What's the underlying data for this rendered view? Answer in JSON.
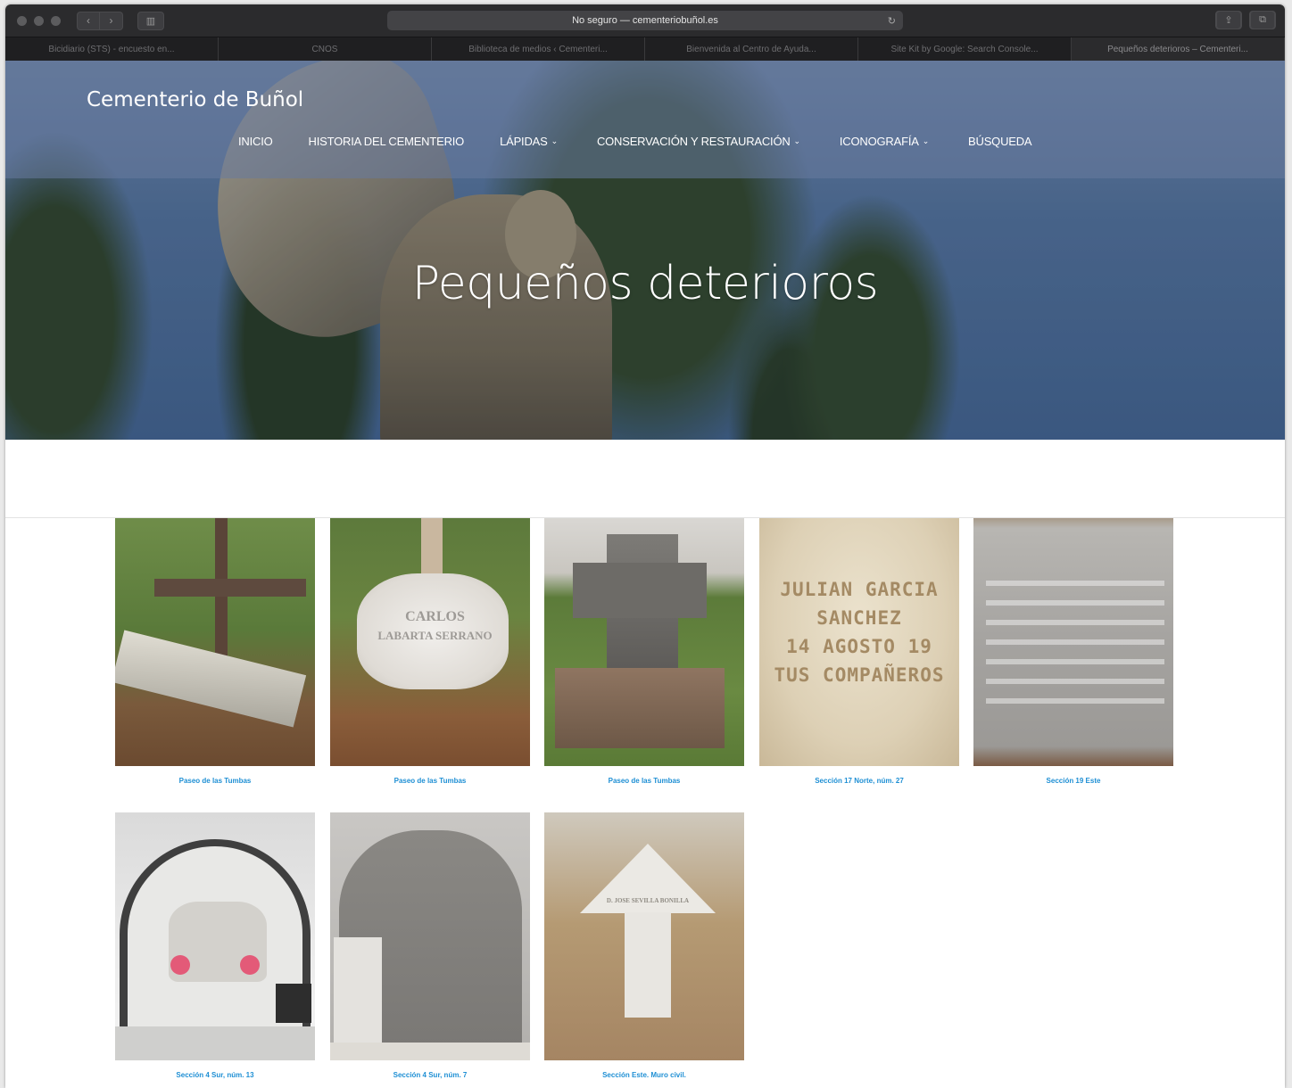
{
  "browser": {
    "url_text": "No seguro — cementeriobuñol.es",
    "tabs": [
      "Bicidiario (STS) - encuesto en...",
      "CNOS",
      "Biblioteca de medios ‹ Cementeri...",
      "Bienvenida al Centro de Ayuda...",
      "Site Kit by Google: Search Console...",
      "Pequeños deterioros – Cementeri..."
    ]
  },
  "site": {
    "title": "Cementerio de Buñol",
    "nav": [
      {
        "label": "INICIO",
        "has_dropdown": false
      },
      {
        "label": "HISTORIA DEL CEMENTERIO",
        "has_dropdown": false
      },
      {
        "label": "LÁPIDAS",
        "has_dropdown": true
      },
      {
        "label": "CONSERVACIÓN Y RESTAURACIÓN",
        "has_dropdown": true
      },
      {
        "label": "ICONOGRAFÍA",
        "has_dropdown": true
      },
      {
        "label": "BÚSQUEDA",
        "has_dropdown": false
      }
    ]
  },
  "page": {
    "title": "Pequeños deterioros"
  },
  "gallery": [
    {
      "caption": "Paseo de las Tumbas",
      "icon": "wooden-cross-photo"
    },
    {
      "caption": "Paseo de las Tumbas",
      "icon": "carlos-labarta-plaque-photo"
    },
    {
      "caption": "Paseo de las Tumbas",
      "icon": "stone-cross-photo"
    },
    {
      "caption": "Sección 17 Norte, núm. 27",
      "icon": "julian-garcia-plaque-photo"
    },
    {
      "caption": "Sección 19 Este",
      "icon": "marble-slab-photo"
    },
    {
      "caption": "Sección 4 Sur, núm. 13",
      "icon": "niche-flowers-photo"
    },
    {
      "caption": "Sección 4 Sur, núm. 7",
      "icon": "grey-niche-photo"
    },
    {
      "caption": "Sección Este. Muro civil.",
      "icon": "arrow-headstone-photo"
    }
  ],
  "photo_text": {
    "carlos": [
      "CARLOS",
      "LABARTA SERRANO"
    ],
    "julian": [
      "JULIAN GARCIA",
      "SANCHEZ",
      "14 AGOSTO 19",
      "TUS COMPAÑEROS"
    ],
    "arrow": "D. JOSE SEVILLA BONILLA"
  },
  "colors": {
    "link": "#1e8fd4",
    "chrome": "#2b2b2d"
  }
}
